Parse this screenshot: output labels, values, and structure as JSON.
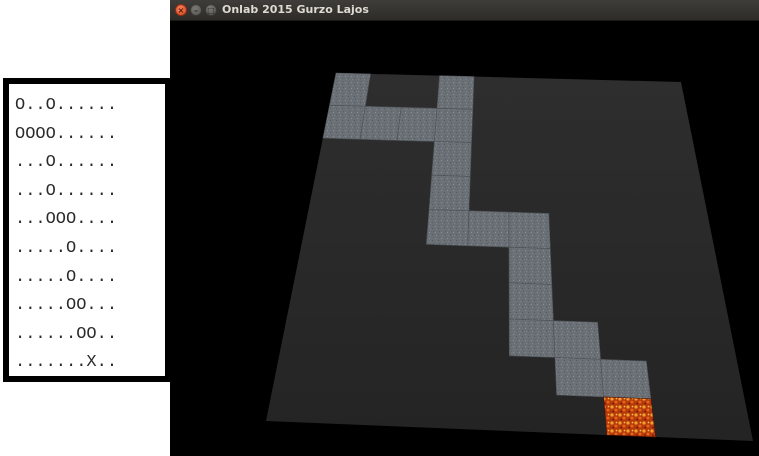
{
  "ascii_map": {
    "lines": [
      "O..O......",
      "OOOO......",
      "...O......",
      "...O......",
      "...OOO....",
      ".....O....",
      ".....O....",
      ".....OO...",
      "......OO..",
      ".......X.."
    ]
  },
  "window": {
    "title": "Onlab 2015 Gurzo Lajos",
    "close_glyph": "×",
    "minimize_glyph": "–",
    "maximize_glyph": "□"
  },
  "scene": {
    "grid_cols": 10,
    "grid_rows": 10,
    "path_cells": [
      [
        0,
        0
      ],
      [
        3,
        0
      ],
      [
        0,
        1
      ],
      [
        1,
        1
      ],
      [
        2,
        1
      ],
      [
        3,
        1
      ],
      [
        3,
        2
      ],
      [
        3,
        3
      ],
      [
        3,
        4
      ],
      [
        4,
        4
      ],
      [
        5,
        4
      ],
      [
        5,
        5
      ],
      [
        5,
        6
      ],
      [
        5,
        7
      ],
      [
        6,
        7
      ],
      [
        6,
        8
      ],
      [
        7,
        8
      ]
    ],
    "goal_cell": [
      7,
      9
    ],
    "colors": {
      "floor": "#2a2a2a",
      "stone": "#6d7378",
      "lava": "#c2410c"
    }
  }
}
